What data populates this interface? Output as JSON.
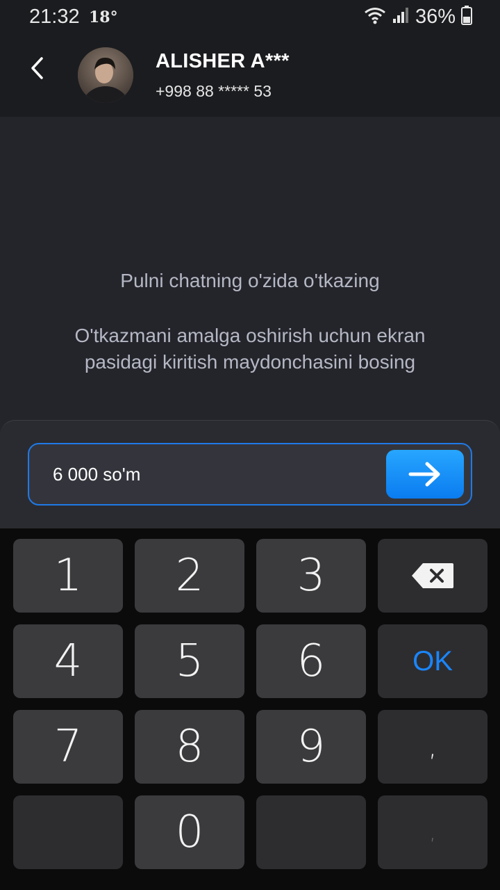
{
  "status_bar": {
    "time": "21:32",
    "temperature": "18°",
    "battery": "36%"
  },
  "header": {
    "name": "ALISHER A***",
    "phone": "+998 88 ***** 53"
  },
  "hint": {
    "title": "Pulni chatning o'zida o'tkazing",
    "line1": "O'tkazmani amalga oshirish uchun ekran",
    "line2": "pasidagi kiritish maydonchasini bosing"
  },
  "amount_input": {
    "value": "6 000 so'm"
  },
  "keypad": {
    "k1": "1",
    "k2": "2",
    "k3": "3",
    "k4": "4",
    "k5": "5",
    "k6": "6",
    "k7": "7",
    "k8": "8",
    "k9": "9",
    "k0": "0",
    "ok": "OK",
    "comma": ",",
    "comma2": ","
  },
  "colors": {
    "accent": "#1a86ff",
    "background": "#24252b",
    "keyboard_bg": "#0b0b0c"
  }
}
